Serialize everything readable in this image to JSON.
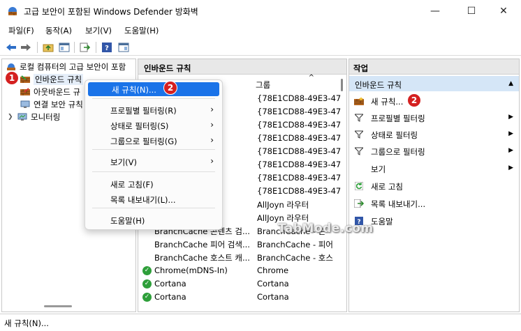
{
  "window": {
    "title": "고급 보안이 포함된 Windows Defender 방화벽",
    "minimize_glyph": "—",
    "maximize_glyph": "☐",
    "close_glyph": "✕"
  },
  "menubar": {
    "items": [
      "파일(F)",
      "동작(A)",
      "보기(V)",
      "도움말(H)"
    ]
  },
  "toolbar": {
    "icons": [
      "back-arrow-icon",
      "forward-arrow-icon",
      "folder-up-icon",
      "console-tree-icon",
      "export-list-icon",
      "help-icon",
      "show-hide-action-pane-icon"
    ]
  },
  "tree": {
    "root": "로컬 컴퓨터의 고급 보안이 포함",
    "items": [
      {
        "label": "인바운드 규칙",
        "selected": true
      },
      {
        "label": "아웃바운드 규"
      },
      {
        "label": "연결 보안 규칙"
      },
      {
        "label": "모니터링",
        "expandable": true
      }
    ]
  },
  "middle": {
    "header": "인바운드 규칙",
    "column_group": "그룹",
    "rows": [
      {
        "name": "",
        "group": "{78E1CD88-49E3-47",
        "checked": false
      },
      {
        "name": "",
        "group": "{78E1CD88-49E3-47",
        "checked": false
      },
      {
        "name": "",
        "group": "{78E1CD88-49E3-47",
        "checked": false
      },
      {
        "name": "",
        "group": "{78E1CD88-49E3-47",
        "checked": false
      },
      {
        "name": "",
        "group": "{78E1CD88-49E3-47",
        "checked": false
      },
      {
        "name": "",
        "group": "{78E1CD88-49E3-47",
        "checked": false
      },
      {
        "name": "",
        "group": "{78E1CD88-49E3-47",
        "checked": false
      },
      {
        "name": "",
        "group": "{78E1CD88-49E3-47",
        "checked": false
      },
      {
        "name": "P-In)",
        "group": "AllJoyn 라우터",
        "checked": false
      },
      {
        "name": "P-In)",
        "group": "AllJoyn 라우터",
        "checked": false
      },
      {
        "name": "BranchCache 콘텐츠 검...",
        "group": "BranchCache - 콘",
        "checked": false
      },
      {
        "name": "BranchCache 피어 검색...",
        "group": "BranchCache - 피어",
        "checked": false
      },
      {
        "name": "BranchCache 호스트 캐...",
        "group": "BranchCache - 호스",
        "checked": false
      },
      {
        "name": "Chrome(mDNS-In)",
        "group": "Chrome",
        "checked": true
      },
      {
        "name": "Cortana",
        "group": "Cortana",
        "checked": true
      },
      {
        "name": "Cortana",
        "group": "Cortana",
        "checked": true
      }
    ]
  },
  "actions": {
    "header": "작업",
    "section": "인바운드 규칙",
    "items": [
      {
        "label": "새 규칙...",
        "icon": "new-rule-icon",
        "submenu": false
      },
      {
        "label": "프로필별 필터링",
        "icon": "filter-icon",
        "submenu": true
      },
      {
        "label": "상태로 필터링",
        "icon": "filter-icon",
        "submenu": true
      },
      {
        "label": "그룹으로 필터링",
        "icon": "filter-icon",
        "submenu": true
      },
      {
        "label": "보기",
        "icon": "",
        "submenu": true
      },
      {
        "label": "새로 고침",
        "icon": "refresh-icon",
        "submenu": false
      },
      {
        "label": "목록 내보내기...",
        "icon": "export-icon",
        "submenu": false
      },
      {
        "label": "도움말",
        "icon": "help-icon",
        "submenu": false
      }
    ]
  },
  "context_menu": {
    "items": [
      {
        "label": "새 규칙(N)...",
        "submenu": false,
        "selected": true
      },
      {
        "label": "프로필별 필터링(R)",
        "submenu": true
      },
      {
        "label": "상태로 필터링(S)",
        "submenu": true
      },
      {
        "label": "그룹으로 필터링(G)",
        "submenu": true
      },
      {
        "label": "보기(V)",
        "submenu": true
      },
      {
        "label": "새로 고침(F)",
        "submenu": false
      },
      {
        "label": "목록 내보내기(L)...",
        "submenu": false
      },
      {
        "label": "도움말(H)",
        "submenu": false
      }
    ]
  },
  "badges": [
    "1",
    "2",
    "2"
  ],
  "status": "새 규칙(N)...",
  "watermark": "TabMode.com",
  "colors": {
    "selection": "#1a73e8",
    "action_section": "#d5e6f7",
    "badge": "#d42020",
    "check": "#2e9f3a"
  }
}
